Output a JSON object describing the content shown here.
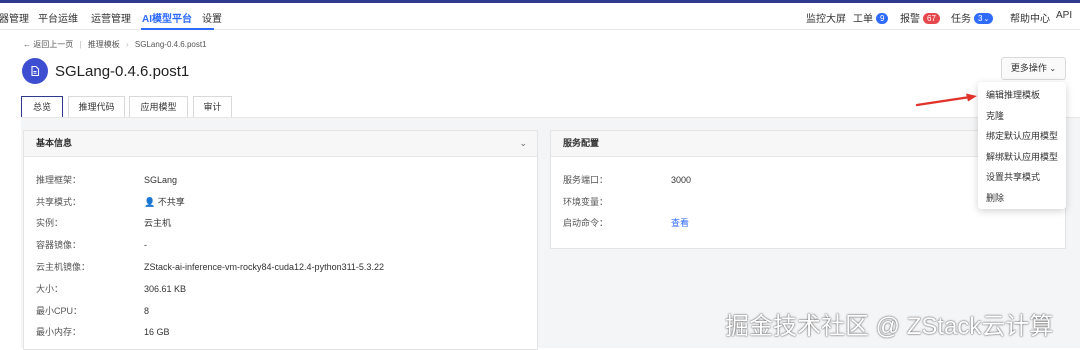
{
  "topnav": {
    "left_items": [
      "器管理",
      "平台运维",
      "运营管理",
      "AI模型平台",
      "设置"
    ],
    "active": "AI模型平台",
    "monitor_screen": "监控大屏",
    "tickets": {
      "label": "工单",
      "count": "9"
    },
    "alerts": {
      "label": "报警",
      "count": "67"
    },
    "tasks": {
      "label": "任务",
      "count": "3"
    },
    "help": "帮助中心",
    "api": "API"
  },
  "breadcrumb": {
    "back": "返回上一页",
    "parent": "推理模板",
    "current": "SGLang-0.4.6.post1"
  },
  "page": {
    "title": "SGLang-0.4.6.post1",
    "more_actions": "更多操作"
  },
  "tabs": [
    "总览",
    "推理代码",
    "应用模型",
    "审计"
  ],
  "basic_info": {
    "title": "基本信息",
    "rows": [
      {
        "label": "推理框架：",
        "value": "SGLang"
      },
      {
        "label": "共享模式：",
        "value": "不共享"
      },
      {
        "label": "实例：",
        "value": "云主机"
      },
      {
        "label": "容器镜像：",
        "value": "-"
      },
      {
        "label": "云主机镜像：",
        "value": "ZStack-ai-inference-vm-rocky84-cuda12.4-python311-5.3.22"
      },
      {
        "label": "大小：",
        "value": "306.61 KB"
      },
      {
        "label": "最小CPU：",
        "value": "8"
      },
      {
        "label": "最小内存：",
        "value": "16 GB"
      }
    ]
  },
  "service_config": {
    "title": "服务配置",
    "rows": [
      {
        "label": "服务端口：",
        "value": "3000"
      },
      {
        "label": "环境变量：",
        "value": ""
      },
      {
        "label": "启动命令：",
        "value": "查看"
      }
    ]
  },
  "dropdown_menu": [
    "编辑推理模板",
    "克隆",
    "绑定默认应用模型",
    "解绑默认应用模型",
    "设置共享模式",
    "删除"
  ],
  "watermark": "掘金技术社区 @ ZStack云计算",
  "colors": {
    "accent": "#2f6bff",
    "brand": "#2f3a8f",
    "alert": "#e5484d",
    "arrow": "#e0322b"
  }
}
